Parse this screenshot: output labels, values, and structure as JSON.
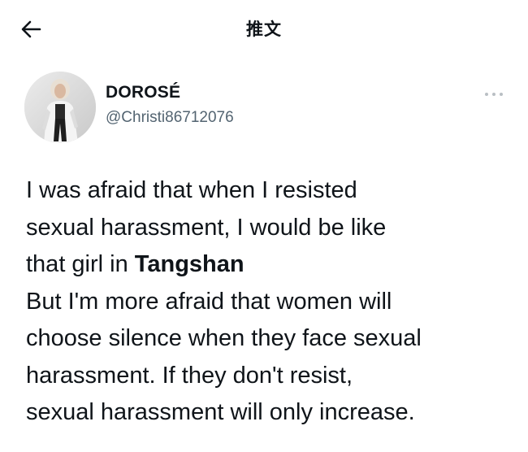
{
  "header": {
    "title": "推文",
    "back_icon": "arrow-left-icon"
  },
  "author": {
    "display_name": "DOROSÉ",
    "handle": "@Christi86712076",
    "avatar_icon": "profile-photo"
  },
  "menu": {
    "icon": "more-horizontal-icon"
  },
  "tweet": {
    "line1": "I was afraid that when I resisted",
    "line2": "sexual harassment, I would be like",
    "line3_prefix": "that girl in ",
    "line3_bold": "Tangshan",
    "line4": "But I'm more afraid that women will",
    "line5": "choose silence when they face sexual",
    "line6": "harassment. If they don't resist,",
    "line7": "sexual harassment will only increase."
  },
  "colors": {
    "text": "#0f1419",
    "secondary": "#536471",
    "background": "#ffffff"
  }
}
